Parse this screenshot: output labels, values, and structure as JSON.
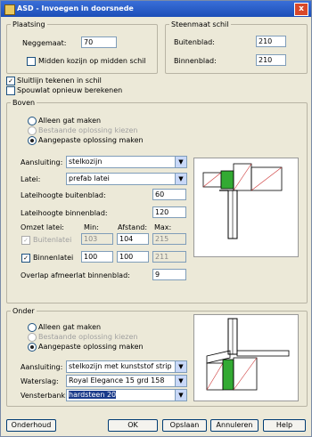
{
  "window": {
    "title": "ASD - Invoegen in doorsnede",
    "close": "x"
  },
  "plaatsing": {
    "legend": "Plaatsing",
    "neggemaat_label": "Neggemaat:",
    "neggemaat_value": "70",
    "midden_label": "Midden kozijn op midden schil",
    "midden_checked": ""
  },
  "steenmaat": {
    "legend": "Steenmaat schil",
    "buitenblad_label": "Buitenblad:",
    "buitenblad_value": "210",
    "binnenblad_label": "Binnenblad:",
    "binnenblad_value": "210"
  },
  "options": {
    "sluitlijn_label": "Sluitlijn tekenen in schil",
    "sluitlijn_mark": "✓",
    "spouwlat_label": "Spouwlat opnieuw berekenen",
    "spouwlat_mark": ""
  },
  "boven": {
    "legend": "Boven",
    "radio_gat": "Alleen gat maken",
    "radio_bestaande": "Bestaande oplossing kiezen",
    "radio_aangepast": "Aangepaste oplossing maken",
    "selected": "aangepast",
    "aansluiting_label": "Aansluiting:",
    "aansluiting_value": "stelkozijn",
    "latei_label": "Latei:",
    "latei_value": "prefab latei",
    "lateihoogte_buiten_label": "Lateihoogte buitenblad:",
    "lateihoogte_buiten_value": "60",
    "lateihoogte_binnen_label": "Lateihoogte binnenblad:",
    "lateihoogte_binnen_value": "120",
    "col_omzet": "Omzet latei:",
    "col_min": "Min:",
    "col_afstand": "Afstand:",
    "col_max": "Max:",
    "buitenlatei_label": "Buitenlatei",
    "buitenlatei_mark": "✓",
    "buitenlatei_min": "103",
    "buitenlatei_afstand": "104",
    "buitenlatei_max": "215",
    "binnenlatei_label": "Binnenlatei",
    "binnenlatei_mark": "✓",
    "binnenlatei_min": "100",
    "binnenlatei_afstand": "100",
    "binnenlatei_max": "211",
    "overlap_label": "Overlap afmeerlat binnenblad:",
    "overlap_value": "9"
  },
  "onder": {
    "legend": "Onder",
    "radio_gat": "Alleen gat maken",
    "radio_bestaande": "Bestaande oplossing kiezen",
    "radio_aangepast": "Aangepaste oplossing maken",
    "selected": "aangepast",
    "aansluiting_label": "Aansluiting:",
    "aansluiting_value": "stelkozijn met kunststof strip",
    "waterslag_label": "Waterslag:",
    "waterslag_value": "Royal Elegance 15 grd 158",
    "vensterbank_label": "Vensterbank:",
    "vensterbank_value": "hardsteen 20"
  },
  "buttons": {
    "onderhoud": "Onderhoud",
    "ok": "OK",
    "opslaan": "Opslaan",
    "annuleren": "Annuleren",
    "help": "Help"
  },
  "colors": {
    "title_bar": "#2a5fc8",
    "dialog_bg": "#ece9d8",
    "selection": "#1a3a8a"
  }
}
